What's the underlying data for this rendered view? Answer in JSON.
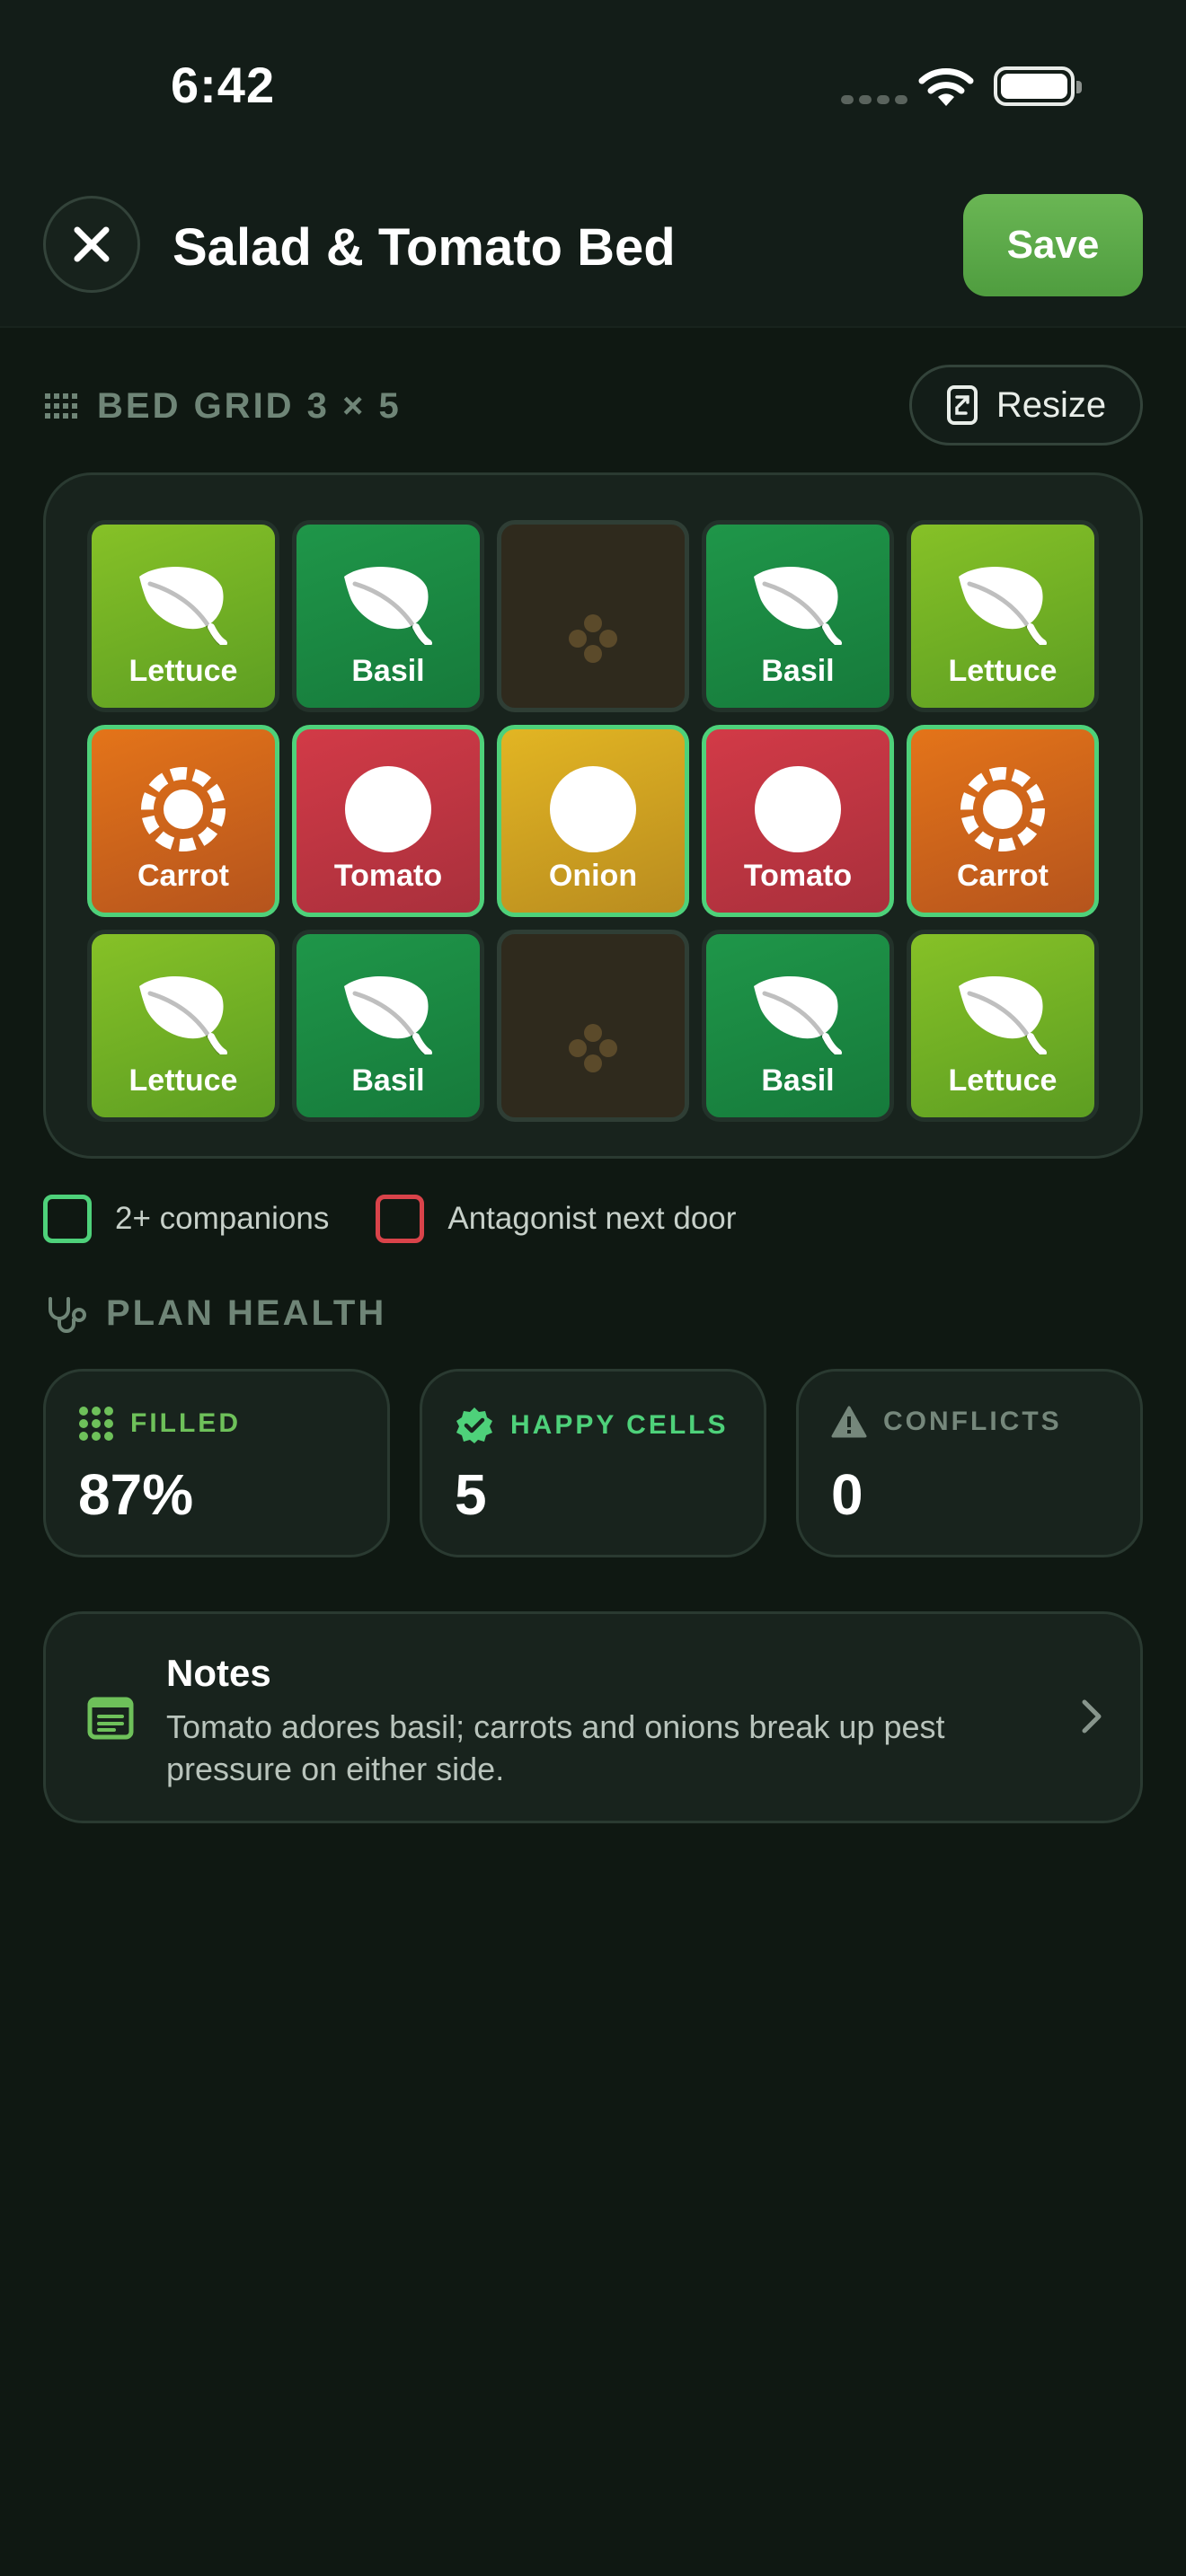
{
  "status_bar": {
    "time": "6:42",
    "icons": [
      "cellular-dots-icon",
      "wifi-icon",
      "battery-icon"
    ]
  },
  "header": {
    "title": "Salad & Tomato Bed",
    "save_label": "Save",
    "close_icon": "close-icon"
  },
  "grid": {
    "section_label": "BED GRID 3 × 5",
    "resize_label": "Resize",
    "rows": 3,
    "columns": 5,
    "cells": [
      [
        {
          "plant": "Lettuce",
          "icon": "leaf-icon",
          "color": "#86c127",
          "companion": false
        },
        {
          "plant": "Basil",
          "icon": "leaf-icon",
          "color": "#1f9649",
          "companion": false
        },
        {
          "plant": "",
          "icon": "empty-plot-icon",
          "color": "#2f2a1d",
          "companion": false
        },
        {
          "plant": "Basil",
          "icon": "leaf-icon",
          "color": "#1f9649",
          "companion": false
        },
        {
          "plant": "Lettuce",
          "icon": "leaf-icon",
          "color": "#86c127",
          "companion": false
        }
      ],
      [
        {
          "plant": "Carrot",
          "icon": "carrot-ring-icon",
          "color": "#e47419",
          "companion": true
        },
        {
          "plant": "Tomato",
          "icon": "circle-icon",
          "color": "#d23a47",
          "companion": true
        },
        {
          "plant": "Onion",
          "icon": "circle-icon",
          "color": "#e2b523",
          "companion": true
        },
        {
          "plant": "Tomato",
          "icon": "circle-icon",
          "color": "#d23a47",
          "companion": true
        },
        {
          "plant": "Carrot",
          "icon": "carrot-ring-icon",
          "color": "#e47419",
          "companion": true
        }
      ],
      [
        {
          "plant": "Lettuce",
          "icon": "leaf-icon",
          "color": "#86c127",
          "companion": false
        },
        {
          "plant": "Basil",
          "icon": "leaf-icon",
          "color": "#1f9649",
          "companion": false
        },
        {
          "plant": "",
          "icon": "empty-plot-icon",
          "color": "#2f2a1d",
          "companion": false
        },
        {
          "plant": "Basil",
          "icon": "leaf-icon",
          "color": "#1f9649",
          "companion": false
        },
        {
          "plant": "Lettuce",
          "icon": "leaf-icon",
          "color": "#86c127",
          "companion": false
        }
      ]
    ]
  },
  "legend": {
    "companions_label": "2+ companions",
    "companions_color": "#4ed17a",
    "antagonist_label": "Antagonist next door",
    "antagonist_color": "#d9434a"
  },
  "health": {
    "section_label": "PLAN HEALTH",
    "stats": {
      "filled": {
        "label": "FILLED",
        "value": "87%",
        "color": "#6ec15a",
        "icon": "grid-dots-icon"
      },
      "happy": {
        "label": "HAPPY CELLS",
        "value": "5",
        "color": "#4ed17a",
        "icon": "verified-badge-icon"
      },
      "conflicts": {
        "label": "CONFLICTS",
        "value": "0",
        "color": "#75877b",
        "icon": "warning-icon"
      }
    }
  },
  "notes": {
    "title": "Notes",
    "body": "Tomato adores basil; carrots and onions break up pest pressure on either side."
  }
}
